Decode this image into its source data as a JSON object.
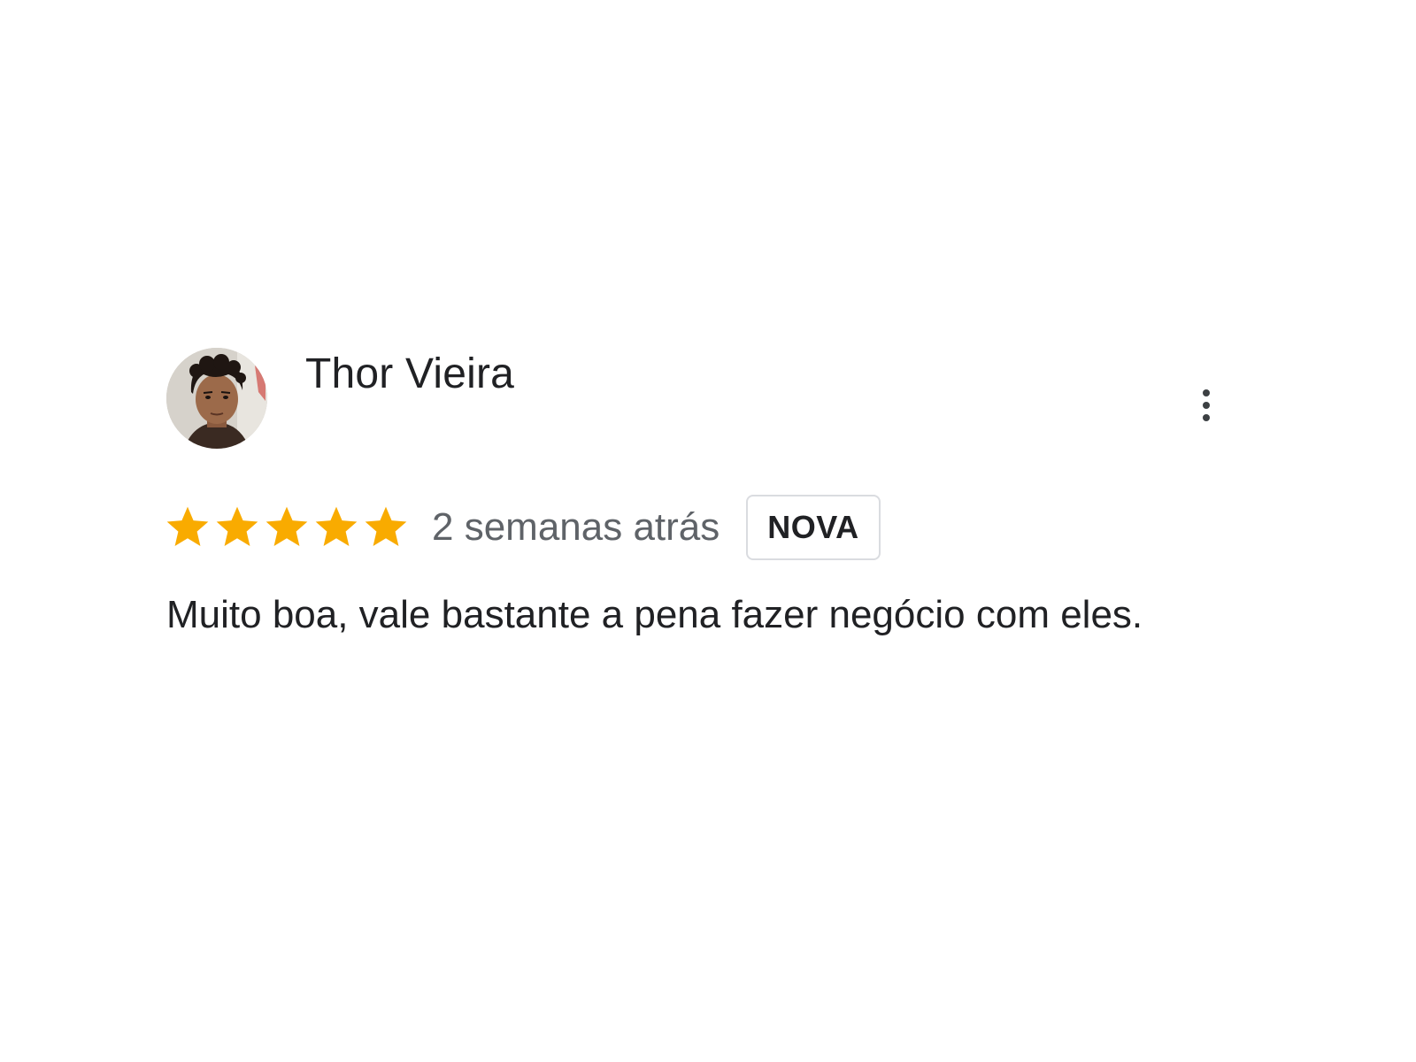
{
  "review": {
    "author_name": "Thor Vieira",
    "rating": 5,
    "rating_max": 5,
    "time_ago": "2 semanas atrás",
    "badge": "NOVA",
    "text": "Muito boa, vale bastante a pena fazer negócio com eles.",
    "star_color": "#f9ab00"
  },
  "icons": {
    "star": "star-icon",
    "more": "more-vert-icon",
    "avatar": "avatar-photo"
  }
}
